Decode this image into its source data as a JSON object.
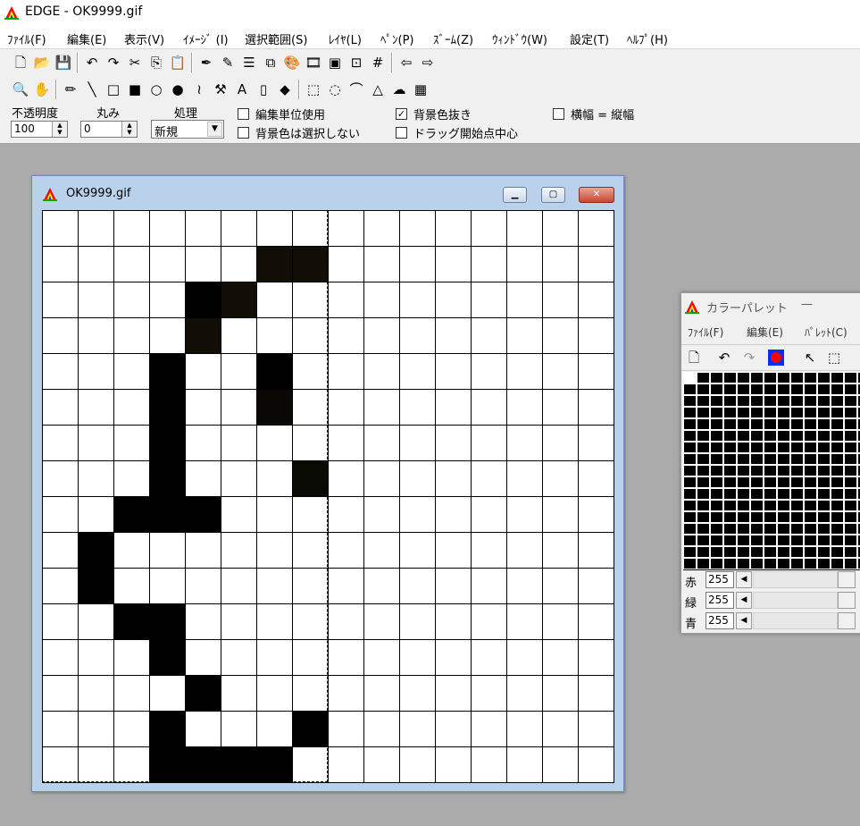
{
  "app": {
    "title": "EDGE - OK9999.gif"
  },
  "menu": [
    "ﾌｧｲﾙ(F)",
    "編集(E)",
    "表示(V)",
    "ｲﾒｰｼﾞ (I)",
    "選択範囲(S)",
    "ﾚｲﾔ(L)",
    "ﾍﾟﾝ(P)",
    "ｽﾞｰﾑ(Z)",
    "ｳｨﾝﾄﾞｳ(W)",
    "設定(T)",
    "ﾍﾙﾌﾟ(H)"
  ],
  "toolbar1": [
    {
      "name": "new-icon",
      "glyph": "🗋"
    },
    {
      "name": "open-icon",
      "glyph": "📂"
    },
    {
      "name": "save-icon",
      "glyph": "💾"
    },
    {
      "name": "undo-icon",
      "glyph": "↶"
    },
    {
      "name": "redo-icon",
      "glyph": "↷"
    },
    {
      "name": "cut-icon",
      "glyph": "✂"
    },
    {
      "name": "copy-icon",
      "glyph": "⎘"
    },
    {
      "name": "paste-icon",
      "glyph": "📋"
    },
    {
      "name": "pen-layer-icon",
      "glyph": "✒"
    },
    {
      "name": "pen-select-icon",
      "glyph": "✎"
    },
    {
      "name": "line-width-icon",
      "glyph": "☰"
    },
    {
      "name": "layer-icon",
      "glyph": "⧉"
    },
    {
      "name": "palette-icon",
      "glyph": "🎨"
    },
    {
      "name": "animation-icon",
      "glyph": "🎞"
    },
    {
      "name": "preview-icon",
      "glyph": "▣"
    },
    {
      "name": "frame-icon",
      "glyph": "⊡"
    },
    {
      "name": "grid-icon",
      "glyph": "#"
    },
    {
      "name": "back-icon",
      "glyph": "⇦"
    },
    {
      "name": "forward-icon",
      "glyph": "⇨"
    }
  ],
  "toolbar2": [
    {
      "name": "zoom-icon",
      "glyph": "🔍"
    },
    {
      "name": "hand-icon",
      "glyph": "✋"
    },
    {
      "name": "pencil-icon",
      "glyph": "✏"
    },
    {
      "name": "line-icon",
      "glyph": "╲"
    },
    {
      "name": "rect-icon",
      "glyph": "□"
    },
    {
      "name": "filled-rect-icon",
      "glyph": "■"
    },
    {
      "name": "ellipse-icon",
      "glyph": "○"
    },
    {
      "name": "filled-ellipse-icon",
      "glyph": "●"
    },
    {
      "name": "curve-icon",
      "glyph": "≀"
    },
    {
      "name": "hammer-icon",
      "glyph": "⚒"
    },
    {
      "name": "text-icon",
      "glyph": "A"
    },
    {
      "name": "spray-icon",
      "glyph": "▯"
    },
    {
      "name": "fill-icon",
      "glyph": "◆"
    },
    {
      "name": "select-rect-icon",
      "glyph": "⬚"
    },
    {
      "name": "select-ellipse-icon",
      "glyph": "◌"
    },
    {
      "name": "lasso-icon",
      "glyph": "⌒"
    },
    {
      "name": "polygon-select-icon",
      "glyph": "△"
    },
    {
      "name": "magic-select-icon",
      "glyph": "☁"
    },
    {
      "name": "pattern-select-icon",
      "glyph": "▦"
    }
  ],
  "options": {
    "opacity_label": "不透明度",
    "opacity_value": "100",
    "round_label": "丸み",
    "round_value": "0",
    "process_label": "処理",
    "process_value": "新規",
    "edit_unit_label": "編集単位使用",
    "edit_unit_checked": false,
    "bg_no_select_label": "背景色は選択しない",
    "bg_no_select_checked": false,
    "bg_transparent_label": "背景色抜き",
    "bg_transparent_checked": true,
    "drag_center_label": "ドラッグ開始点中心",
    "drag_center_checked": false,
    "aspect_label": "横幅 = 縦幅",
    "aspect_checked": false
  },
  "image_window": {
    "caption": "OK9999.gif",
    "rows": 16,
    "cols": 16,
    "pixels": [
      [
        1,
        6,
        "#120d05"
      ],
      [
        1,
        7,
        "#120d05"
      ],
      [
        2,
        4,
        "#000000"
      ],
      [
        2,
        5,
        "#120d05"
      ],
      [
        3,
        4,
        "#120d05"
      ],
      [
        4,
        3,
        "#000000"
      ],
      [
        4,
        6,
        "#000000"
      ],
      [
        5,
        3,
        "#000000"
      ],
      [
        5,
        6,
        "#0a0805"
      ],
      [
        6,
        3,
        "#000000"
      ],
      [
        7,
        3,
        "#000000"
      ],
      [
        7,
        7,
        "#0a0a05"
      ],
      [
        8,
        2,
        "#000000"
      ],
      [
        8,
        3,
        "#000000"
      ],
      [
        8,
        4,
        "#000000"
      ],
      [
        9,
        1,
        "#000000"
      ],
      [
        10,
        1,
        "#000000"
      ],
      [
        11,
        2,
        "#000000"
      ],
      [
        11,
        3,
        "#000000"
      ],
      [
        12,
        3,
        "#000000"
      ],
      [
        13,
        4,
        "#000000"
      ],
      [
        14,
        3,
        "#000000"
      ],
      [
        14,
        7,
        "#000000"
      ],
      [
        15,
        3,
        "#000000"
      ],
      [
        15,
        4,
        "#000000"
      ],
      [
        15,
        5,
        "#000000"
      ],
      [
        15,
        6,
        "#000000"
      ]
    ]
  },
  "palette_window": {
    "caption": "カラーパレット",
    "minimize_glyph": "—",
    "menu": [
      "ﾌｧｲﾙ(F)",
      "編集(E)",
      "ﾊﾟﾚｯﾄ(C)"
    ],
    "rows": [
      {
        "label": "赤",
        "value": "255"
      },
      {
        "label": "緑",
        "value": "255"
      },
      {
        "label": "青",
        "value": "255"
      }
    ],
    "selected_color": "#ffffff"
  }
}
